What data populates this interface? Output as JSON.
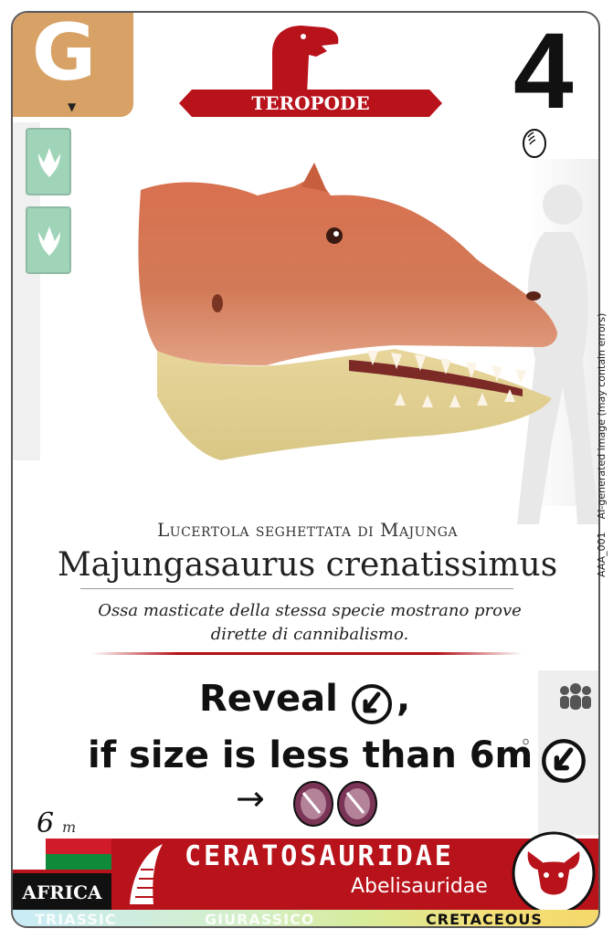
{
  "grade": {
    "letter": "G"
  },
  "category": {
    "label": "TEROPODE"
  },
  "card_number": "4",
  "credit": {
    "code": "AAA_001",
    "note": "AI-generated image (may contain errors)"
  },
  "names": {
    "common": "Lucertola seghettata di Majunga",
    "scientific": "Majungasaurus crenatissimus"
  },
  "fact": "Ossa masticate della stessa specie mostrano prove dirette di cannibalismo.",
  "ability": {
    "line1": "Reveal",
    "line1_suffix": ",",
    "line2": "if size is less than 6m",
    "arrow": "→"
  },
  "size": {
    "value": "6",
    "unit": "m"
  },
  "region": "AFRICA",
  "taxonomy": {
    "family": "CERATOSAURIDAE",
    "subfamily": "Abelisauridae"
  },
  "eras": {
    "triassic": "TRIASSIC",
    "jurassic": "GIURASSICO",
    "cretaceous": "CRETACEOUS"
  },
  "icons": {
    "tracks": [
      "footprint-icon",
      "footprint-icon"
    ],
    "crest": "theropod-head-icon",
    "egg": "egg-icon",
    "reveal": "claw-reveal-icon",
    "gems": [
      "gem-icon",
      "gem-icon"
    ],
    "people": "people-icon",
    "diet": "bull-head-icon",
    "claw": "claw-icon"
  },
  "colors": {
    "accent_red": "#b8121b",
    "grade_tan": "#d8a165",
    "track_green": "#9fd4b8",
    "gem_purple": "#7a3456"
  }
}
